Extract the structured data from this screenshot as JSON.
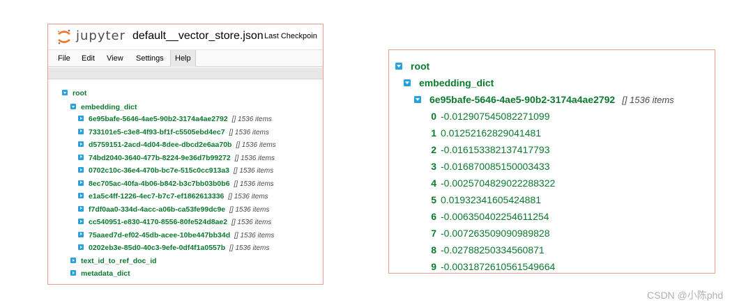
{
  "colors": {
    "accent_border": "#ef9a8e",
    "toggle_blue": "#2aa0dd",
    "key_green": "#0b7a2e",
    "jupyter_orange": "#f37726"
  },
  "left": {
    "logo_text": "jupyter",
    "notebook_title": "default__vector_store.json",
    "checkpoint": "Last Checkpoin",
    "menu": [
      "File",
      "Edit",
      "View",
      "Settings",
      "Help"
    ],
    "tree": {
      "root": "root",
      "embedding_dict": "embedding_dict",
      "items": [
        {
          "id": "6e95bafe-5646-4ae5-90b2-3174a4ae2792",
          "meta": "[] 1536 items"
        },
        {
          "id": "733101e5-c3e8-4f93-bf1f-c5505ebd4ec7",
          "meta": "[] 1536 items"
        },
        {
          "id": "d5759151-2acd-4d04-8dee-dbcd2e6aa70b",
          "meta": "[] 1536 items"
        },
        {
          "id": "74bd2040-3640-477b-8224-9e36d7b99272",
          "meta": "[] 1536 items"
        },
        {
          "id": "0702c10c-36e4-470b-bc7e-515c0cc913a3",
          "meta": "[] 1536 items"
        },
        {
          "id": "8ec705ac-40fa-4b06-b842-b3c7bb03b0b6",
          "meta": "[] 1536 items"
        },
        {
          "id": "e1a5c4ff-1226-4ec7-b7c7-ef1862613336",
          "meta": "[] 1536 items"
        },
        {
          "id": "f7df0aa0-334d-4acc-a06b-ca53fe99dc9e",
          "meta": "[] 1536 items"
        },
        {
          "id": "cc540951-e830-4170-8556-80fe524d8ae2",
          "meta": "[] 1536 items"
        },
        {
          "id": "75aaed7d-ef02-45db-acee-10be447bb34d",
          "meta": "[] 1536 items"
        },
        {
          "id": "0202eb3e-85d0-40c3-9efe-0df4f1a0557b",
          "meta": "[] 1536 items"
        }
      ],
      "text_id_to_ref_doc_id": "text_id_to_ref_doc_id",
      "metadata_dict": "metadata_dict"
    }
  },
  "right": {
    "root": "root",
    "embedding_dict": "embedding_dict",
    "item_id": "6e95bafe-5646-4ae5-90b2-3174a4ae2792",
    "item_meta": "[] 1536 items",
    "values": [
      {
        "i": "0",
        "v": "-0.012907545082271099"
      },
      {
        "i": "1",
        "v": "0.01252162829041481"
      },
      {
        "i": "2",
        "v": "-0.016153382137417793"
      },
      {
        "i": "3",
        "v": "-0.016870085150003433"
      },
      {
        "i": "4",
        "v": "-0.0025704829022288322"
      },
      {
        "i": "5",
        "v": "0.01932341605424881"
      },
      {
        "i": "6",
        "v": "-0.006350402254611254"
      },
      {
        "i": "7",
        "v": "-0.007263509090989828"
      },
      {
        "i": "8",
        "v": "-0.02788250334560871"
      },
      {
        "i": "9",
        "v": "-0.0031872610561549664"
      }
    ]
  },
  "watermark": "CSDN @小陈phd"
}
